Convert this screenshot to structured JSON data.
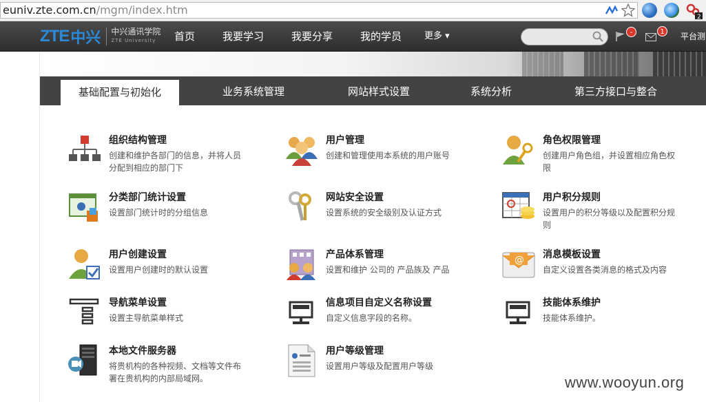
{
  "browser": {
    "url_host": "euniv.zte.com.cn",
    "url_path": "/mgm/index.htm"
  },
  "header": {
    "logo_zte": "ZTE",
    "logo_zh": "中兴",
    "logo_uni_cn": "中兴通讯学院",
    "logo_uni_en": "ZTE University",
    "nav": [
      "首页",
      "我要学习",
      "我要分享",
      "我的学员",
      "更多 ▾"
    ],
    "flag_badge": "-",
    "mail_badge": "1",
    "platform": "平台测"
  },
  "tabs": [
    {
      "label": "基础配置与初始化",
      "active": true
    },
    {
      "label": "业务系统管理",
      "active": false
    },
    {
      "label": "网站样式设置",
      "active": false
    },
    {
      "label": "系统分析",
      "active": false
    },
    {
      "label": "第三方接口与整合",
      "active": false
    }
  ],
  "items": [
    {
      "title": "组织结构管理",
      "desc": "创建和维护各部门的信息，并将人员分配到相应的部门下",
      "icon": "org-chart-icon"
    },
    {
      "title": "用户管理",
      "desc": "创建和管理使用本系统的用户账号",
      "icon": "users-group-icon"
    },
    {
      "title": "角色权限管理",
      "desc": "创建用户角色组，并设置相应角色权限",
      "icon": "user-key-icon"
    },
    {
      "title": "分类部门统计设置",
      "desc": "设置部门统计时的分组信息",
      "icon": "dept-stats-icon"
    },
    {
      "title": "网站安全设置",
      "desc": "设置系统的安全级别及认证方式",
      "icon": "keys-icon"
    },
    {
      "title": "用户积分规则",
      "desc": "设置用户的积分等级以及配置积分规则",
      "icon": "points-calendar-icon"
    },
    {
      "title": "用户创建设置",
      "desc": "设置用户创建时的默认设置",
      "icon": "user-check-icon"
    },
    {
      "title": "产品体系管理",
      "desc": "设置和维护 公司的 产品族及 产品",
      "icon": "product-building-icon"
    },
    {
      "title": "消息模板设置",
      "desc": "自定义设置各类消息的格式及内容",
      "icon": "email-at-icon"
    },
    {
      "title": "导航菜单设置",
      "desc": "设置主导航菜单样式",
      "icon": "nav-menu-icon"
    },
    {
      "title": "信息项目自定义名称设置",
      "desc": "自定义信息字段的名称。",
      "icon": "monitor-icon"
    },
    {
      "title": "技能体系维护",
      "desc": "技能体系维护。",
      "icon": "monitor-icon"
    },
    {
      "title": "本地文件服务器",
      "desc": "将贵机构的各种视频、文档等文件布署在贵机构的内部局域网。",
      "icon": "file-server-icon"
    },
    {
      "title": "用户等级管理",
      "desc": "设置用户等级及配置用户等级",
      "icon": "document-list-icon"
    }
  ],
  "watermark": "www.wooyun.org",
  "colors": {
    "tabbar": "#434343",
    "header": "#3a3a3a",
    "accent_blue": "#2a8ad8",
    "badge_red": "#d9382d"
  }
}
